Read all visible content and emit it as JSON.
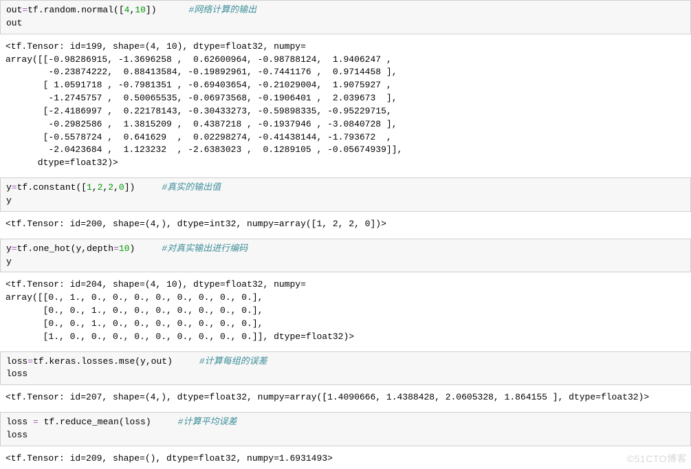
{
  "cells": [
    {
      "input_html": "out<span class=\"tk-op\">=</span>tf.random.normal([<span class=\"tk-num\">4</span>,<span class=\"tk-num\">10</span>])      <span class=\"tk-com\">#网络计算的输出</span>\nout",
      "output": "<tf.Tensor: id=199, shape=(4, 10), dtype=float32, numpy=\narray([[-0.98286915, -1.3696258 ,  0.62600964, -0.98788124,  1.9406247 ,\n        -0.23874222,  0.88413584, -0.19892961, -0.7441176 ,  0.9714458 ],\n       [ 1.0591718 , -0.7981351 , -0.69403654, -0.21029004,  1.9075927 ,\n        -1.2745757 ,  0.50065535, -0.06973568, -0.1906401 ,  2.039673  ],\n       [-2.4186997 ,  0.22178143, -0.30433273, -0.59898335, -0.95229715,\n        -0.2982586 ,  1.3815209 ,  0.4387218 , -0.1937946 , -3.0840728 ],\n       [-0.5578724 ,  0.641629  ,  0.02298274, -0.41438144, -1.793672  ,\n        -2.0423684 ,  1.123232  , -2.6383023 ,  0.1289105 , -0.05674939]],\n      dtype=float32)>"
    },
    {
      "input_html": "y<span class=\"tk-op\">=</span>tf.constant([<span class=\"tk-num\">1</span>,<span class=\"tk-num\">2</span>,<span class=\"tk-num\">2</span>,<span class=\"tk-num\">0</span>])     <span class=\"tk-com\">#真实的输出值</span>\ny",
      "output": "<tf.Tensor: id=200, shape=(4,), dtype=int32, numpy=array([1, 2, 2, 0])>"
    },
    {
      "input_html": "y<span class=\"tk-op\">=</span>tf.one_hot(y,depth<span class=\"tk-op\">=</span><span class=\"tk-num\">10</span>)     <span class=\"tk-com\">#对真实输出进行编码</span>\ny",
      "output": "<tf.Tensor: id=204, shape=(4, 10), dtype=float32, numpy=\narray([[0., 1., 0., 0., 0., 0., 0., 0., 0., 0.],\n       [0., 0., 1., 0., 0., 0., 0., 0., 0., 0.],\n       [0., 0., 1., 0., 0., 0., 0., 0., 0., 0.],\n       [1., 0., 0., 0., 0., 0., 0., 0., 0., 0.]], dtype=float32)>"
    },
    {
      "input_html": "loss<span class=\"tk-op\">=</span>tf.keras.losses.mse(y,out)     <span class=\"tk-com\">#计算每组的误差</span>\nloss",
      "output": "<tf.Tensor: id=207, shape=(4,), dtype=float32, numpy=array([1.4090666, 1.4388428, 2.0605328, 1.864155 ], dtype=float32)>"
    },
    {
      "input_html": "loss <span class=\"tk-op\">=</span> tf.reduce_mean(loss)     <span class=\"tk-com\">#计算平均误差</span>\nloss",
      "output": "<tf.Tensor: id=209, shape=(), dtype=float32, numpy=1.6931493>"
    }
  ],
  "watermark": "©51CTO博客"
}
